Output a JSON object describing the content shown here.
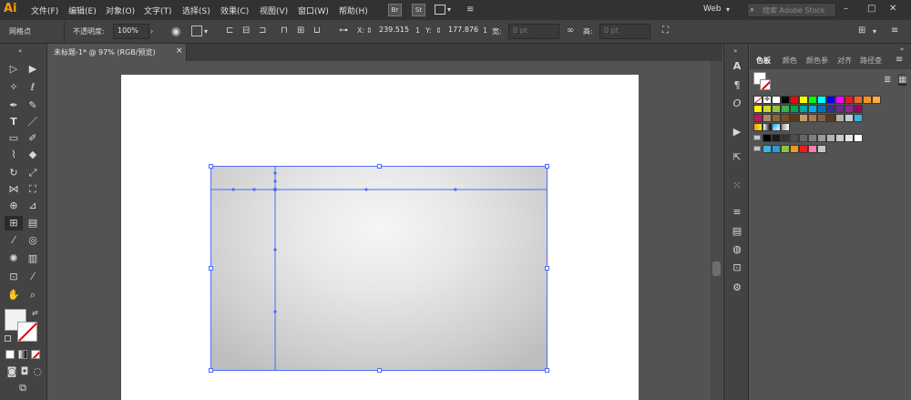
{
  "app": {
    "logo": "Ai"
  },
  "menu": [
    "文件(F)",
    "编辑(E)",
    "对象(O)",
    "文字(T)",
    "选择(S)",
    "效果(C)",
    "视图(V)",
    "窗口(W)",
    "帮助(H)"
  ],
  "menu_buttons": {
    "bridge": "Br",
    "stock": "St"
  },
  "workspace": {
    "label": "Web"
  },
  "search": {
    "placeholder": "搜索 Adobe Stock"
  },
  "control_bar": {
    "selection_label": "网格点",
    "opacity_label": "不透明度:",
    "opacity_value": "100%",
    "x_label": "X:",
    "x_value": "239.515",
    "x_unit": "1",
    "y_label": "Y:",
    "y_value": "177.876",
    "y_unit": "1",
    "width_label": "宽:",
    "width_value": "0 pt",
    "height_label": "高:",
    "height_value": "0 pt"
  },
  "document_tab": {
    "title": "未标题-1* @ 97% (RGB/预览)",
    "close": "×"
  },
  "panel": {
    "tabs": [
      "色板",
      "颜色",
      "颜色参",
      "对齐",
      "路径查"
    ],
    "active_tab": "色板"
  },
  "colors": {
    "accent": "#ff9a00",
    "selection": "#4a6cf7",
    "canvas": "#535353",
    "artboard": "#ffffff"
  },
  "swatches": {
    "row1": [
      "#ffffff",
      "#000000",
      "#ff0000",
      "#ffff00",
      "#00ff00",
      "#00ffff",
      "#0000ff",
      "#ff00ff",
      "#e31b23",
      "#f26522",
      "#f7941d",
      "#fbaf3f"
    ],
    "row2": [
      "#fff200",
      "#cbdb2a",
      "#8dc63f",
      "#39b54a",
      "#00a651",
      "#00a99d",
      "#00aeef",
      "#0072bc",
      "#2e3192",
      "#662d91",
      "#92278f",
      "#9e005d"
    ],
    "row3": [
      "#c2185b",
      "#b0876b",
      "#8c6239",
      "#754c24",
      "#603913",
      "#c69c6d",
      "#a67c52",
      "#8b5e3c",
      "#5a3a1e",
      "#b3b3b3",
      "#cccccc",
      "#36b5e0"
    ],
    "gray_row": [
      "#000000",
      "#1a1a1a",
      "#333333",
      "#4d4d4d",
      "#666666",
      "#808080",
      "#999999",
      "#b3b3b3",
      "#cccccc",
      "#e6e6e6",
      "#ffffff"
    ],
    "group_row": [
      "#36b5e0",
      "#2e9ad0",
      "#8cc63f",
      "#f7941d",
      "#ec1c24",
      "#ff7bac",
      "#c7c7c7"
    ]
  }
}
